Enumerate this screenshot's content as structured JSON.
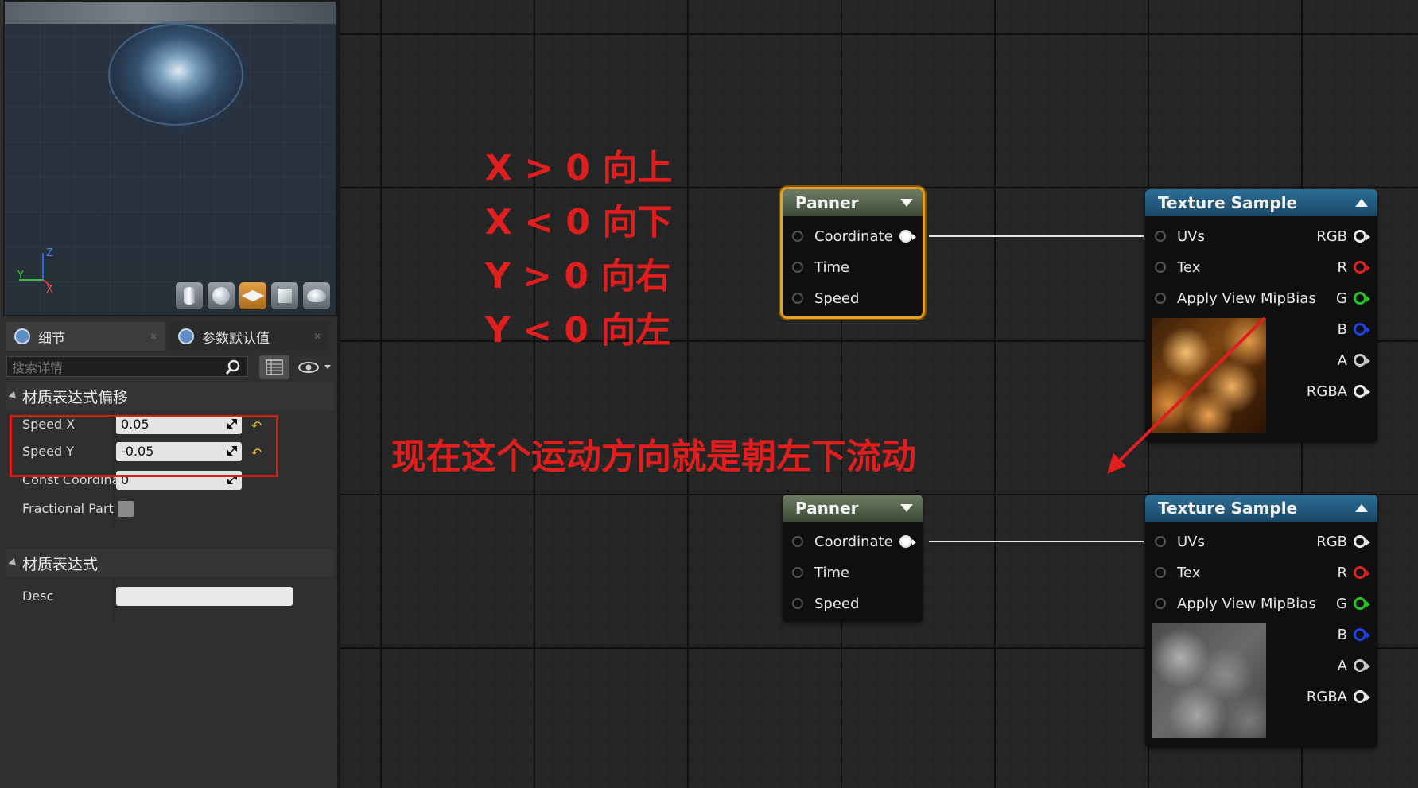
{
  "details_panel": {
    "tabs": [
      {
        "label": "细节",
        "icon": "details-icon"
      },
      {
        "label": "参数默认值",
        "icon": "params-icon"
      }
    ],
    "search": {
      "placeholder": "搜索详情"
    },
    "sections": [
      {
        "title": "材质表达式偏移",
        "properties": [
          {
            "label": "Speed X",
            "value": "0.05"
          },
          {
            "label": "Speed Y",
            "value": "-0.05"
          },
          {
            "label": "Const Coordinat",
            "value": "0"
          },
          {
            "label": "Fractional Part",
            "value": false
          }
        ]
      },
      {
        "title": "材质表达式",
        "properties": [
          {
            "label": "Desc",
            "value": ""
          }
        ]
      }
    ]
  },
  "viewport": {
    "axis": {
      "x": "X",
      "y": "Y",
      "z": "Z"
    },
    "preview_buttons": [
      "cylinder-icon",
      "sphere-icon",
      "plane-icon",
      "cube-icon",
      "teapot-icon"
    ],
    "active_preview": "plane-icon"
  },
  "graph": {
    "nodes": [
      {
        "title": "Panner",
        "selected": true,
        "inputs": [
          "Coordinate",
          "Time",
          "Speed"
        ]
      },
      {
        "title": "Texture Sample",
        "inputs": [
          "UVs",
          "Tex",
          "Apply View MipBias"
        ],
        "outputs": [
          {
            "label": "RGB",
            "color": "#e8e8e8"
          },
          {
            "label": "R",
            "color": "#e02020"
          },
          {
            "label": "G",
            "color": "#22c422"
          },
          {
            "label": "B",
            "color": "#2040e0"
          },
          {
            "label": "A",
            "color": "#c8c8c8"
          },
          {
            "label": "RGBA",
            "color": "#e8e8e8"
          }
        ],
        "texture": "fire"
      },
      {
        "title": "Panner",
        "selected": false,
        "inputs": [
          "Coordinate",
          "Time",
          "Speed"
        ]
      },
      {
        "title": "Texture Sample",
        "inputs": [
          "UVs",
          "Tex",
          "Apply View MipBias"
        ],
        "outputs": [
          {
            "label": "RGB",
            "color": "#e8e8e8"
          },
          {
            "label": "R",
            "color": "#e02020"
          },
          {
            "label": "G",
            "color": "#22c422"
          },
          {
            "label": "B",
            "color": "#2040e0"
          },
          {
            "label": "A",
            "color": "#c8c8c8"
          },
          {
            "label": "RGBA",
            "color": "#e8e8e8"
          }
        ],
        "texture": "clouds"
      }
    ]
  },
  "annotations": {
    "rules": [
      "X > 0 向上",
      "X < 0 向下",
      "Y > 0 向右",
      "Y < 0 向左"
    ],
    "note": "现在这个运动方向就是朝左下流动",
    "color": "#e01e1e"
  }
}
